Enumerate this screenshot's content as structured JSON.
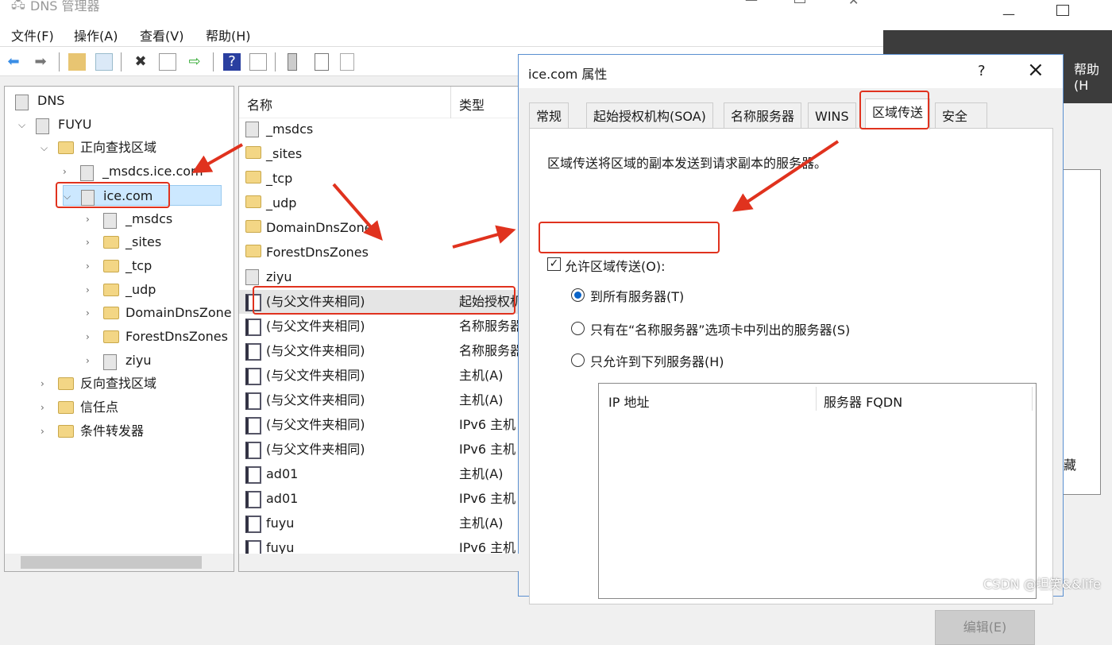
{
  "main_window": {
    "title": "DNS 管理器",
    "menu": [
      "文件(F)",
      "操作(A)",
      "查看(V)",
      "帮助(H)"
    ],
    "toolbar_icons": [
      "back-icon",
      "forward-icon",
      "up-folder-icon",
      "show-hide-tree-icon",
      "delete-icon",
      "properties-icon",
      "export-icon",
      "help-icon",
      "action-pane-icon",
      "server-icon",
      "list-icon",
      "copy-icon"
    ],
    "tree": [
      {
        "label": "DNS",
        "level": 0,
        "icon": "dns-icon"
      },
      {
        "label": "FUYU",
        "level": 1,
        "icon": "server-icon",
        "expanded": true
      },
      {
        "label": "正向查找区域",
        "level": 2,
        "icon": "folder-icon",
        "expanded": true
      },
      {
        "label": "_msdcs.ice.com",
        "level": 3,
        "icon": "zone-icon"
      },
      {
        "label": "ice.com",
        "level": 3,
        "icon": "zone-icon",
        "expanded": true,
        "selected": true
      },
      {
        "label": "_msdcs",
        "level": 4,
        "icon": "zone-icon"
      },
      {
        "label": "_sites",
        "level": 4,
        "icon": "folder-icon"
      },
      {
        "label": "_tcp",
        "level": 4,
        "icon": "folder-icon"
      },
      {
        "label": "_udp",
        "level": 4,
        "icon": "folder-icon"
      },
      {
        "label": "DomainDnsZone",
        "level": 4,
        "icon": "folder-icon"
      },
      {
        "label": "ForestDnsZones",
        "level": 4,
        "icon": "folder-icon"
      },
      {
        "label": "ziyu",
        "level": 4,
        "icon": "zone-icon"
      },
      {
        "label": "反向查找区域",
        "level": 2,
        "icon": "folder-icon"
      },
      {
        "label": "信任点",
        "level": 2,
        "icon": "folder-icon"
      },
      {
        "label": "条件转发器",
        "level": 2,
        "icon": "folder-icon"
      }
    ],
    "list": {
      "columns": [
        "名称",
        "类型"
      ],
      "rows": [
        {
          "name": "_msdcs",
          "type": "",
          "icon": "zone"
        },
        {
          "name": "_sites",
          "type": "",
          "icon": "folder"
        },
        {
          "name": "_tcp",
          "type": "",
          "icon": "folder"
        },
        {
          "name": "_udp",
          "type": "",
          "icon": "folder"
        },
        {
          "name": "DomainDnsZones",
          "type": "",
          "icon": "folder"
        },
        {
          "name": "ForestDnsZones",
          "type": "",
          "icon": "folder"
        },
        {
          "name": "ziyu",
          "type": "",
          "icon": "zone"
        },
        {
          "name": "(与父文件夹相同)",
          "type": "起始授权机",
          "icon": "record"
        },
        {
          "name": "(与父文件夹相同)",
          "type": "名称服务器",
          "icon": "record"
        },
        {
          "name": "(与父文件夹相同)",
          "type": "名称服务器",
          "icon": "record"
        },
        {
          "name": "(与父文件夹相同)",
          "type": "主机(A)",
          "icon": "record"
        },
        {
          "name": "(与父文件夹相同)",
          "type": "主机(A)",
          "icon": "record"
        },
        {
          "name": "(与父文件夹相同)",
          "type": "IPv6 主机",
          "icon": "record"
        },
        {
          "name": "(与父文件夹相同)",
          "type": "IPv6 主机",
          "icon": "record"
        },
        {
          "name": "ad01",
          "type": "主机(A)",
          "icon": "record"
        },
        {
          "name": "ad01",
          "type": "IPv6 主机",
          "icon": "record"
        },
        {
          "name": "fuyu",
          "type": "主机(A)",
          "icon": "record"
        },
        {
          "name": "fuyu",
          "type": "IPv6 主机",
          "icon": "record"
        }
      ]
    }
  },
  "background_window": {
    "menu_text": "帮助(H",
    "side_text": "藏"
  },
  "dialog": {
    "title": "ice.com 属性",
    "help": "?",
    "close": "×",
    "tabs": [
      "常规",
      "起始授权机构(SOA)",
      "名称服务器",
      "WINS",
      "区域传送",
      "安全"
    ],
    "active_tab": "区域传送",
    "description": "区域传送将区域的副本发送到请求副本的服务器。",
    "allow_checkbox": {
      "label": "允许区域传送(O):",
      "checked": true
    },
    "options": [
      {
        "label": "到所有服务器(T)",
        "selected": true
      },
      {
        "label": "只有在“名称服务器”选项卡中列出的服务器(S)",
        "selected": false
      },
      {
        "label": "只允许到下列服务器(H)",
        "selected": false
      }
    ],
    "server_table": {
      "columns": [
        "IP 地址",
        "服务器 FQDN"
      ]
    },
    "edit_button": "编辑(E)"
  },
  "watermark": "CSDN @坦笑&&life",
  "colors": {
    "annotation": "#e0321e",
    "radio_selected": "#0a64c8"
  }
}
